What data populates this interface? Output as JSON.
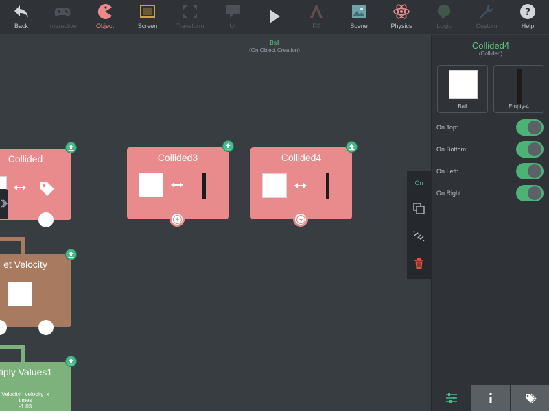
{
  "toolbar": {
    "items": [
      {
        "label": "Back",
        "icon": "back-arrow-icon",
        "state": "normal"
      },
      {
        "label": "Interactive",
        "icon": "gamepad-icon",
        "state": "disabled"
      },
      {
        "label": "Object",
        "icon": "pacman-icon",
        "state": "active"
      },
      {
        "label": "Screen",
        "icon": "screen-icon",
        "state": "normal"
      },
      {
        "label": "Transform",
        "icon": "transform-icon",
        "state": "disabled"
      },
      {
        "label": "UI",
        "icon": "ui-icon",
        "state": "disabled"
      },
      {
        "label": "",
        "icon": "play-icon",
        "state": "normal"
      },
      {
        "label": "FX",
        "icon": "fx-icon",
        "state": "disabled"
      },
      {
        "label": "Scene",
        "icon": "scene-icon",
        "state": "normal"
      },
      {
        "label": "Physics",
        "icon": "atom-icon",
        "state": "normal"
      },
      {
        "label": "Logic",
        "icon": "brain-icon",
        "state": "disabled"
      },
      {
        "label": "Custom",
        "icon": "wrench-icon",
        "state": "disabled"
      },
      {
        "label": "Help",
        "icon": "help-icon",
        "state": "normal"
      }
    ]
  },
  "canvas": {
    "object_name": "Ball",
    "event_name": "(On Object Creation)",
    "nodes": {
      "collided": {
        "title": "Collided"
      },
      "collided3": {
        "title": "Collided3"
      },
      "collided4": {
        "title": "Collided4"
      },
      "set_velocity": {
        "title": "et Velocity"
      },
      "multiply": {
        "title": "tiply Values1",
        "line1": "Velocity : velocity_x",
        "line2": "times",
        "line3": "-1.03"
      }
    }
  },
  "side_tools": {
    "on_label": "On"
  },
  "panel": {
    "title": "Collided4",
    "subtitle": "(Collided)",
    "objects": [
      {
        "label": "Ball"
      },
      {
        "label": "Empty-4"
      }
    ],
    "properties": [
      {
        "label": "On Top:",
        "value": true
      },
      {
        "label": "On Bottom:",
        "value": true
      },
      {
        "label": "On Left:",
        "value": true
      },
      {
        "label": "On Right:",
        "value": true
      }
    ]
  },
  "colors": {
    "accent_green": "#5fbf7f",
    "node_red": "#e98b8c",
    "node_brown": "#a87b60",
    "node_green": "#7db27d",
    "toggle_on": "#4cb276",
    "delete_red": "#e0533c"
  }
}
